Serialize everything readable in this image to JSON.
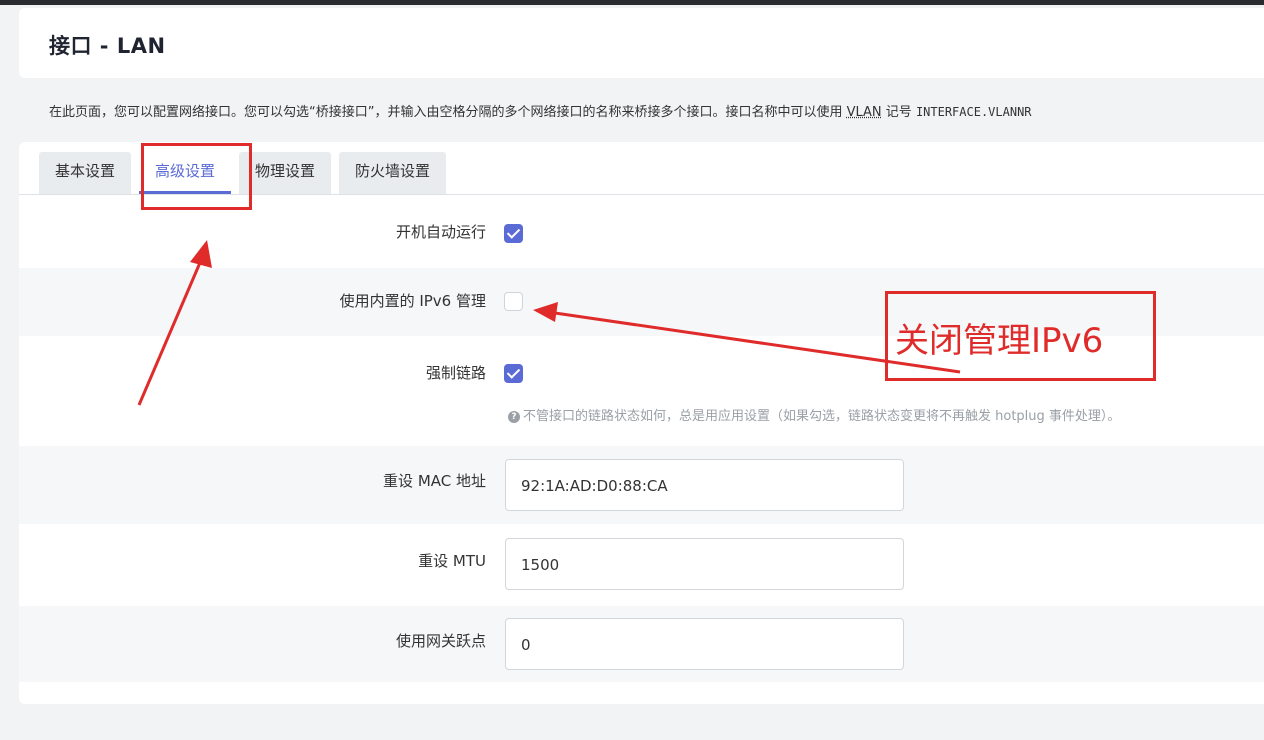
{
  "header": {
    "title": "接口 - LAN"
  },
  "description": {
    "part1": "在此页面，您可以配置网络接口。您可以勾选“桥接接口”，并输入由空格分隔的多个网络接口的名称来桥接多个接口。接口名称中可以使用 ",
    "link": "VLAN",
    "part2": " 记号 ",
    "code": "INTERFACE.VLANNR"
  },
  "tabs": [
    {
      "label": "基本设置",
      "active": false
    },
    {
      "label": "高级设置",
      "active": true
    },
    {
      "label": "物理设置",
      "active": false
    },
    {
      "label": "防火墙设置",
      "active": false
    }
  ],
  "settings": {
    "autostart": {
      "label": "开机自动运行",
      "checked": true
    },
    "ipv6_mgmt": {
      "label": "使用内置的 IPv6 管理",
      "checked": false
    },
    "force_link": {
      "label": "强制链路",
      "checked": true,
      "hint": "不管接口的链路状态如何，总是用应用设置（如果勾选，链路状态变更将不再触发 hotplug 事件处理）。"
    },
    "mac": {
      "label": "重设 MAC 地址",
      "value": "92:1A:AD:D0:88:CA"
    },
    "mtu": {
      "label": "重设 MTU",
      "value": "1500"
    },
    "metric": {
      "label": "使用网关跃点",
      "value": "0"
    }
  },
  "annotation": {
    "text": "关闭管理IPv6",
    "color": "#e02b2b"
  },
  "colors": {
    "accent": "#5b6bd6",
    "annotation": "#e02b2b"
  }
}
